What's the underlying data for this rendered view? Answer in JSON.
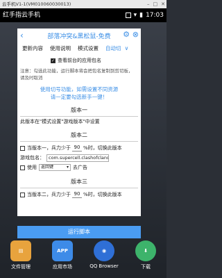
{
  "window": {
    "title": "云手机V1-1(VM010060030013)",
    "controls": [
      "–",
      "□",
      "✕"
    ]
  },
  "statusbar": {
    "app_name": "红手指云手机",
    "time": "17:03"
  },
  "dialog": {
    "title": "部落冲突&黑松鼠-免费",
    "tabs": [
      {
        "label": "更新内容"
      },
      {
        "label": "使用说明"
      },
      {
        "label": "模式设置"
      },
      {
        "label": "自动切"
      }
    ],
    "checkbox_label": "查看前台的应用包名",
    "checkbox_checked": true,
    "note": "注意：勾选此功能，运行脚本将会把包名复制到剪切板，请及时取消",
    "link_line1": "使用切号功能，如需设置不同资源",
    "link_line2": "请一定要勾选新手一键！",
    "version1": {
      "title": "版本一",
      "desc": "此版本在\"模式设置\"游戏版本\"中设置"
    },
    "version2": {
      "title": "版本二",
      "row1_prefix": "当版本一，兵力少于",
      "row1_value": "90",
      "row1_suffix": "%时，切换此版本",
      "pkg_label": "游戏包名：",
      "pkg_value": "com.supercell.clashofclans.qihoo",
      "use_label": "使用",
      "use_select": "返回键",
      "use_suffix": "去广告"
    },
    "version3": {
      "title": "版本三",
      "row1_prefix": "当版本二，兵力少于",
      "row1_value": "90",
      "row1_suffix": "%时，切换此版本"
    },
    "run_button": "运行脚本"
  },
  "dock": [
    {
      "label": "文件管理",
      "icon": "folder-icon",
      "color": "#e8a33d"
    },
    {
      "label": "应用市场",
      "icon": "app-store-icon",
      "color": "#3d8be8"
    },
    {
      "label": "QQ Browser",
      "icon": "browser-icon",
      "color": "#2f6fd6"
    },
    {
      "label": "下载",
      "icon": "download-icon",
      "color": "#3db36b"
    }
  ],
  "colors": {
    "accent": "#3a8ee6",
    "button": "#4a9cf2"
  }
}
